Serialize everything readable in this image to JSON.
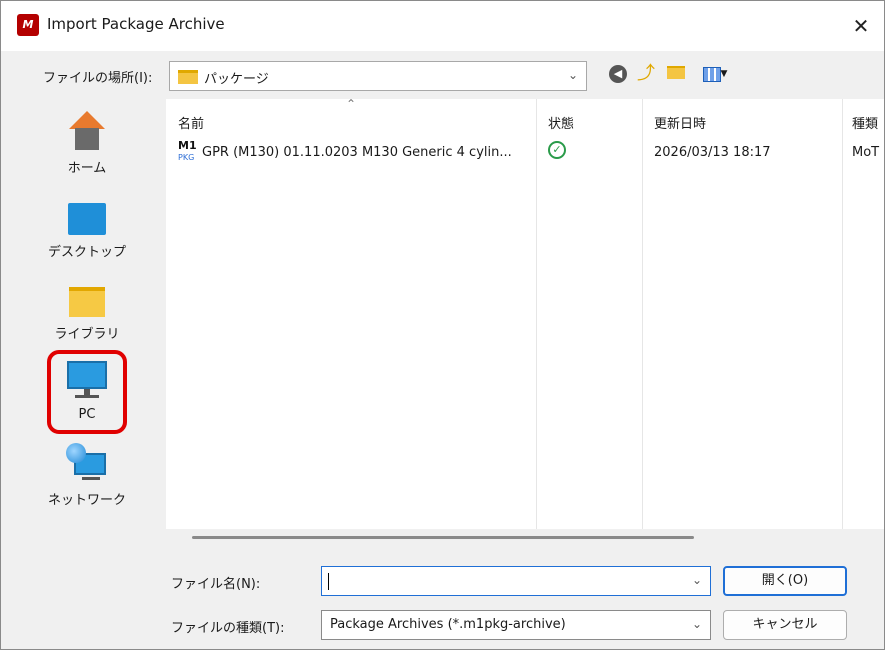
{
  "window": {
    "title": "Import Package Archive",
    "app_icon_text": "M",
    "close_glyph": "✕"
  },
  "toolbar": {
    "lookin_label": "ファイルの場所(I):",
    "lookin_value": "パッケージ",
    "icons": [
      "back-icon",
      "up-folder-icon",
      "new-folder-icon",
      "view-menu-icon"
    ]
  },
  "places": [
    {
      "label": "ホーム",
      "icon": "home-icon"
    },
    {
      "label": "デスクトップ",
      "icon": "desktop-icon"
    },
    {
      "label": "ライブラリ",
      "icon": "library-folder-icon"
    },
    {
      "label": "PC",
      "icon": "pc-icon",
      "highlighted": true
    },
    {
      "label": "ネットワーク",
      "icon": "network-icon"
    }
  ],
  "filelist": {
    "columns": [
      "名前",
      "状態",
      "更新日時",
      "種類"
    ],
    "rows": [
      {
        "icon_top": "M1",
        "icon_bottom": "PKG",
        "name": "GPR (M130) 01.11.0203 M130 Generic 4 cylin...",
        "status_icon": "check-circle-icon",
        "modified": "2026/03/13 18:17",
        "type": "MoT"
      }
    ]
  },
  "footer": {
    "filename_label": "ファイル名(N):",
    "filename_value": "",
    "filetype_label": "ファイルの種類(T):",
    "filetype_value": "Package Archives (*.m1pkg-archive)",
    "open_label": "開く(O)",
    "cancel_label": "キャンセル"
  },
  "colors": {
    "highlight": "#e00000",
    "accent": "#1f6fd6",
    "status_ok": "#2a9b4a"
  }
}
